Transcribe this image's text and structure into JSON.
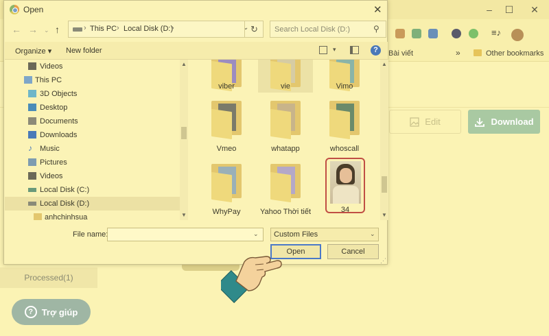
{
  "browser": {
    "bookmarks": {
      "bai_viet": "Bài viết",
      "more": "»",
      "other": "Other bookmarks"
    }
  },
  "page": {
    "edit_label": "Edit",
    "download_label": "Download",
    "processed_tab": "Processed(1)",
    "help_label": "Trợ giúp"
  },
  "dialog": {
    "title": "Open",
    "breadcrumbs": [
      "This PC",
      "Local Disk (D:)"
    ],
    "search_placeholder": "Search Local Disk (D:)",
    "organize_label": "Organize ▾",
    "new_folder_label": "New folder",
    "nav_items": [
      {
        "label": "Videos",
        "icon": "videos-icon",
        "selected": false
      },
      {
        "label": "This PC",
        "icon": "computer-icon",
        "selected": false
      },
      {
        "label": "3D Objects",
        "icon": "3d-objects-icon",
        "selected": false
      },
      {
        "label": "Desktop",
        "icon": "desktop-icon",
        "selected": false
      },
      {
        "label": "Documents",
        "icon": "documents-icon",
        "selected": false
      },
      {
        "label": "Downloads",
        "icon": "downloads-icon",
        "selected": false
      },
      {
        "label": "Music",
        "icon": "music-icon",
        "selected": false
      },
      {
        "label": "Pictures",
        "icon": "pictures-icon",
        "selected": false
      },
      {
        "label": "Videos",
        "icon": "videos-icon",
        "selected": false
      },
      {
        "label": "Local Disk (C:)",
        "icon": "drive-icon",
        "selected": false
      },
      {
        "label": "Local Disk (D:)",
        "icon": "drive-icon",
        "selected": true
      },
      {
        "label": "anhchinhsua",
        "icon": "folder-icon",
        "selected": false
      }
    ],
    "files": [
      {
        "name": "viber",
        "type": "folder"
      },
      {
        "name": "vie",
        "type": "folder"
      },
      {
        "name": "Vimo",
        "type": "folder"
      },
      {
        "name": "Vmeo",
        "type": "folder"
      },
      {
        "name": "whatapp",
        "type": "folder"
      },
      {
        "name": "whoscall",
        "type": "folder"
      },
      {
        "name": "WhyPay",
        "type": "folder"
      },
      {
        "name": "Yahoo Thời tiết",
        "type": "folder"
      },
      {
        "name": "34",
        "type": "image"
      }
    ],
    "file_name_label": "File name:",
    "file_name_value": "",
    "file_type_value": "Custom Files",
    "open_label": "Open",
    "cancel_label": "Cancel"
  },
  "colors": {
    "accent_download": "#a9c9a2",
    "help_button": "#9fb6a4",
    "selection_outline": "#c04e44",
    "overlay_tint": "#fbf3b4"
  }
}
